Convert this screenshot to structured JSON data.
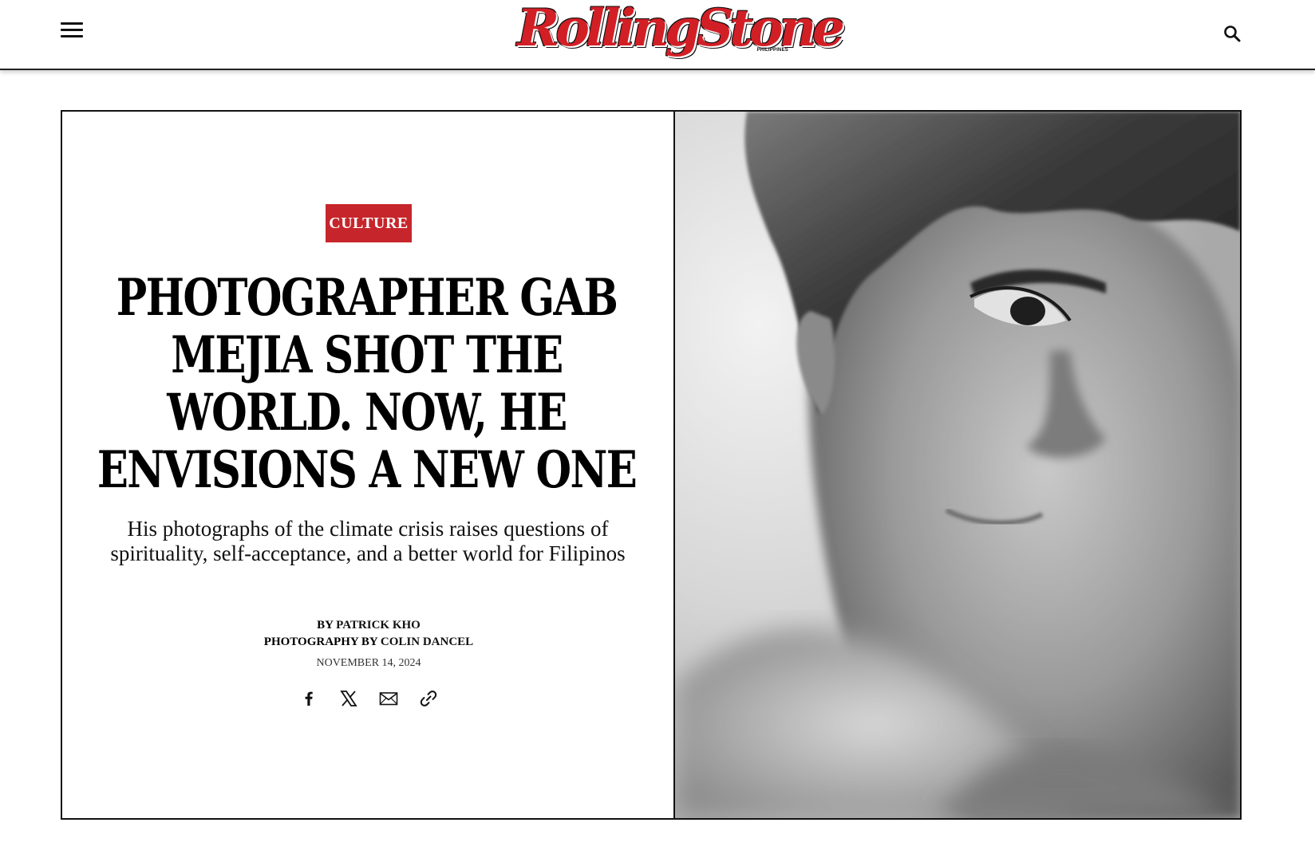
{
  "header": {
    "logo_text": "RollingStone",
    "logo_sub": "PHILIPPINES",
    "icons": {
      "menu": "hamburger-menu-icon",
      "search": "search-icon"
    }
  },
  "article": {
    "category": "CULTURE",
    "headline": "Photographer Gab Mejia Shot the World. Now, He Envisions a New One",
    "dek": "His photographs of the climate crisis raises questions of spirituality, self-acceptance, and a better world for Filipinos",
    "byline_prefix": "BY",
    "author": "PATRICK KHO",
    "photo_prefix": "PHOTOGRAPHY BY",
    "photographer": "COLIN DANCEL",
    "date": "NOVEMBER 14, 2024",
    "share_icons": [
      "facebook-icon",
      "x-icon",
      "email-icon",
      "link-icon"
    ]
  },
  "colors": {
    "brand_red": "#c6262b",
    "border": "#111111"
  }
}
